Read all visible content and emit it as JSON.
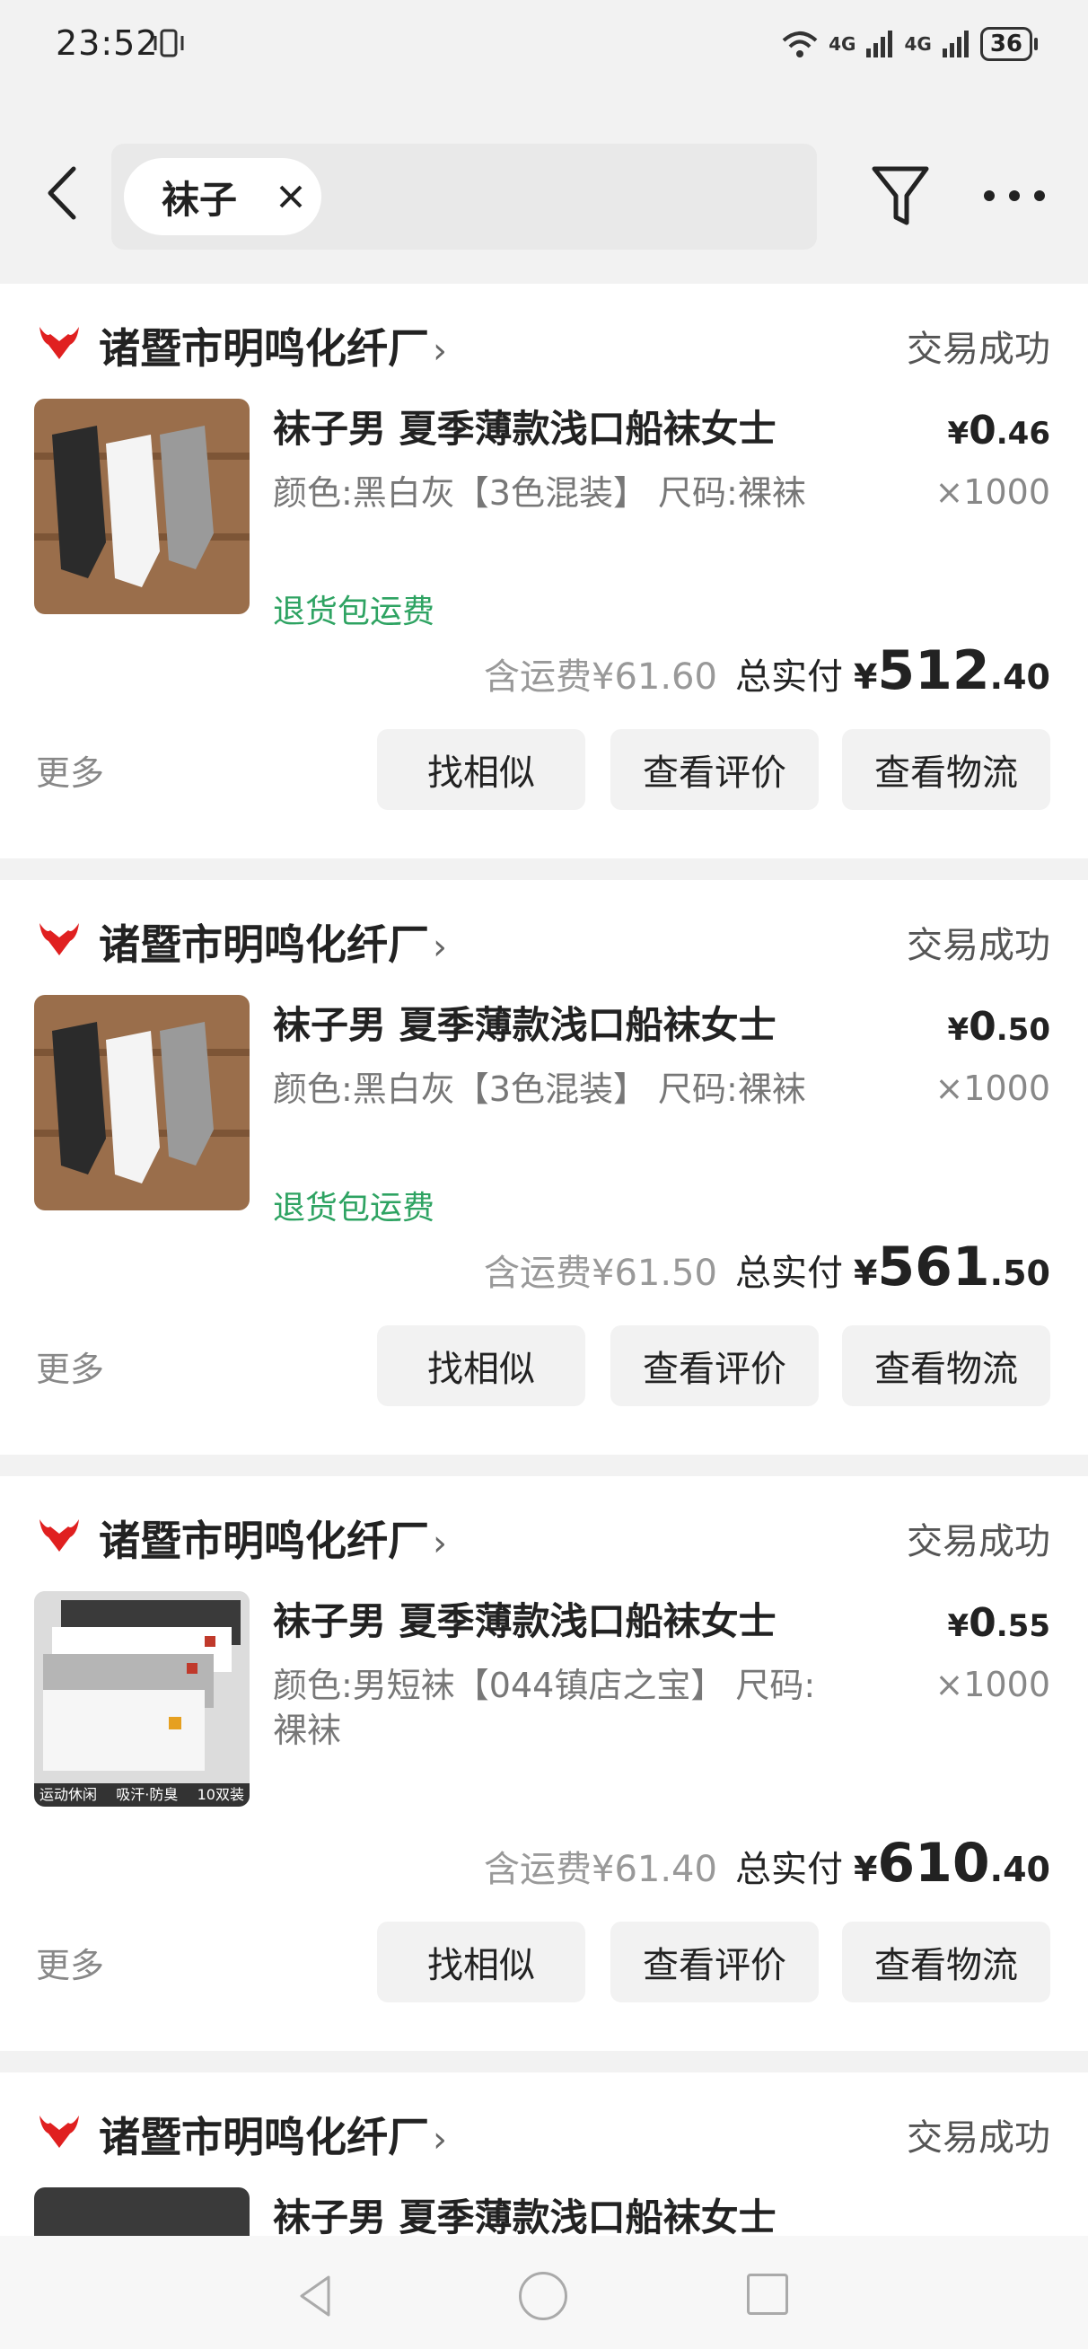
{
  "status_bar": {
    "time": "23:52",
    "network_1": "4G",
    "network_2": "4G",
    "battery": "36"
  },
  "search": {
    "chip_label": "袜子"
  },
  "orders": [
    {
      "shop_name": "诸暨市明鸣化纤厂",
      "status": "交易成功",
      "title": "袜子男 夏季薄款浅口船袜女士",
      "spec": "颜色:黑白灰【3色混装】 尺码:裸袜",
      "tag": "退货包运费",
      "unit_price": {
        "symbol": "¥",
        "int": "0",
        "dec": ".46"
      },
      "quantity": "×1000",
      "shipping": "含运费¥61.60",
      "paid_label": "总实付",
      "paid": {
        "symbol": "¥",
        "int": "512",
        "dec": ".40"
      },
      "more": "更多",
      "buttons": [
        "找相似",
        "查看评价",
        "查看物流"
      ]
    },
    {
      "shop_name": "诸暨市明鸣化纤厂",
      "status": "交易成功",
      "title": "袜子男 夏季薄款浅口船袜女士",
      "spec": "颜色:黑白灰【3色混装】 尺码:裸袜",
      "tag": "退货包运费",
      "unit_price": {
        "symbol": "¥",
        "int": "0",
        "dec": ".50"
      },
      "quantity": "×1000",
      "shipping": "含运费¥61.50",
      "paid_label": "总实付",
      "paid": {
        "symbol": "¥",
        "int": "561",
        "dec": ".50"
      },
      "more": "更多",
      "buttons": [
        "找相似",
        "查看评价",
        "查看物流"
      ]
    },
    {
      "shop_name": "诸暨市明鸣化纤厂",
      "status": "交易成功",
      "title": "袜子男 夏季薄款浅口船袜女士",
      "spec": "颜色:男短袜【044镇店之宝】 尺码:裸袜",
      "tag": "",
      "unit_price": {
        "symbol": "¥",
        "int": "0",
        "dec": ".55"
      },
      "quantity": "×1000",
      "shipping": "含运费¥61.40",
      "paid_label": "总实付",
      "paid": {
        "symbol": "¥",
        "int": "610",
        "dec": ".40"
      },
      "more": "更多",
      "buttons": [
        "找相似",
        "查看评价",
        "查看物流"
      ],
      "thumb_caption": [
        "运动休闲",
        "吸汗·防臭",
        "10双装"
      ]
    },
    {
      "shop_name": "诸暨市明鸣化纤厂",
      "status": "交易成功",
      "title": "袜子男 夏季薄款浅口船袜女士"
    }
  ],
  "colors": {
    "green_tag": "#2ea362",
    "brand_red": "#e02020"
  }
}
